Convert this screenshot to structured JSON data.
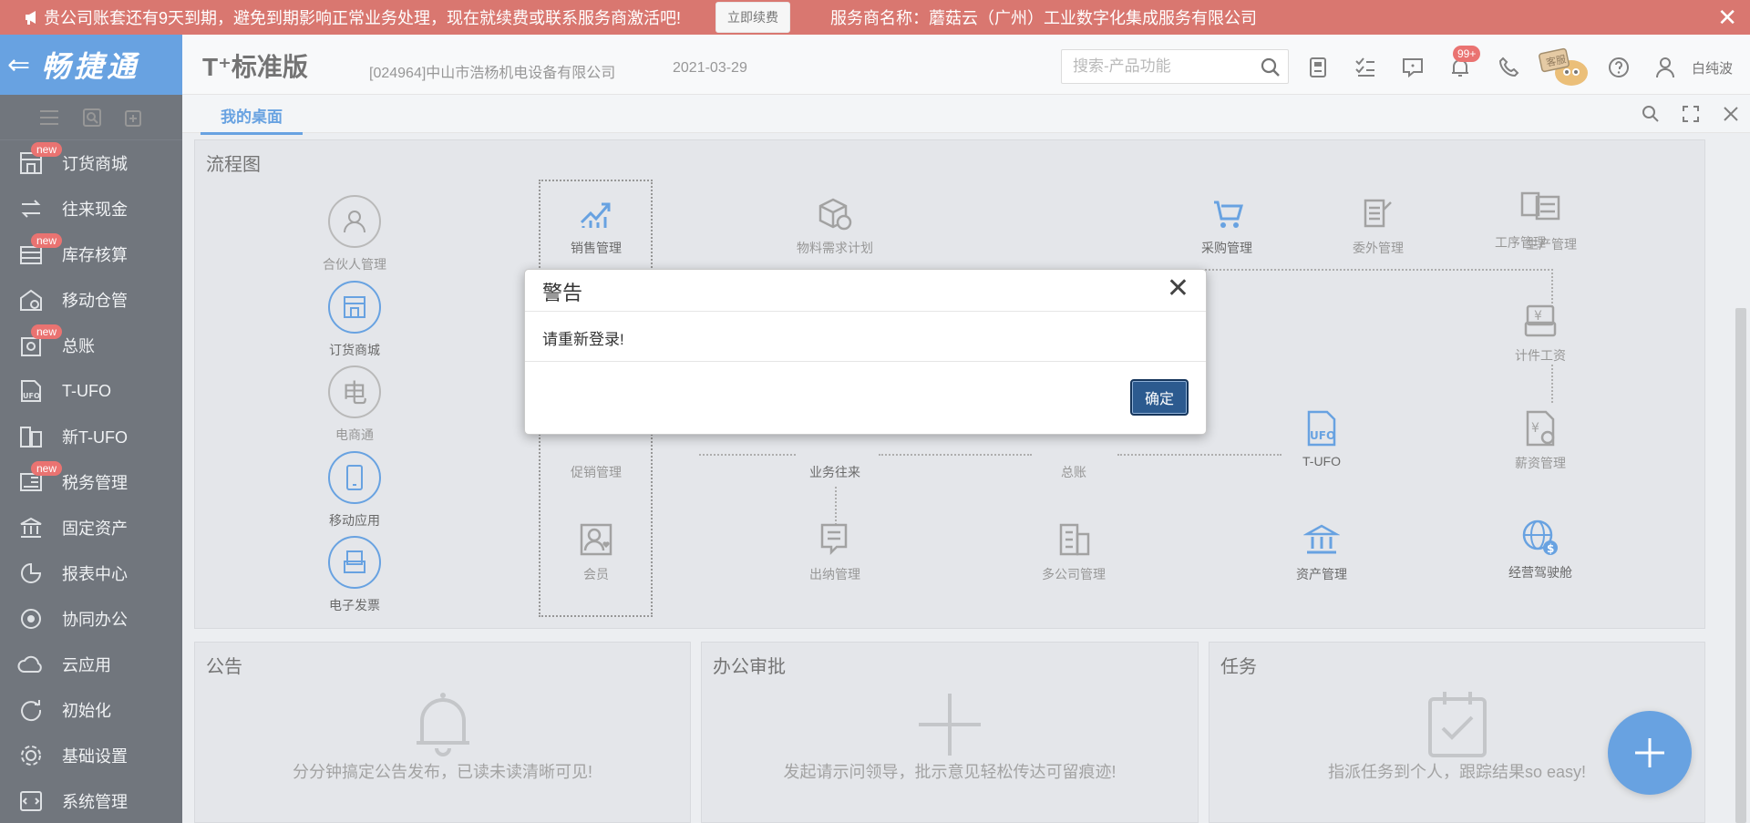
{
  "banner": {
    "message": "贵公司账套还有9天到期，避免到期影响正常业务处理，现在就续费或联系服务商激活吧!",
    "renew_label": "立即续费",
    "provider": "服务商名称：蘑菇云（广州）工业数字化集成服务有限公司",
    "close": "✕"
  },
  "header": {
    "logo_text": "畅捷通",
    "edition": "T⁺标准版",
    "company": "[024964]中山市浩杨机电设备有限公司",
    "date": "2021-03-29",
    "search_placeholder": "搜索-产品功能",
    "notification_badge": "99+",
    "kefu_label": "客服",
    "username": "白纯波"
  },
  "sidebar": {
    "new_badge": "new",
    "items": [
      {
        "label": "订货商城",
        "icon": "store-icon",
        "new": true
      },
      {
        "label": "往来现金",
        "icon": "exchange-icon",
        "new": false
      },
      {
        "label": "库存核算",
        "icon": "inventory-icon",
        "new": true
      },
      {
        "label": "移动仓管",
        "icon": "warehouse-icon",
        "new": false
      },
      {
        "label": "总账",
        "icon": "ledger-icon",
        "new": true
      },
      {
        "label": "T-UFO",
        "icon": "ufo-icon",
        "new": false
      },
      {
        "label": "新T-UFO",
        "icon": "new-ufo-icon",
        "new": false
      },
      {
        "label": "税务管理",
        "icon": "tax-icon",
        "new": true
      },
      {
        "label": "固定资产",
        "icon": "bank-icon",
        "new": false
      },
      {
        "label": "报表中心",
        "icon": "pie-icon",
        "new": false
      },
      {
        "label": "协同办公",
        "icon": "collab-icon",
        "new": false
      },
      {
        "label": "云应用",
        "icon": "cloud-icon",
        "new": false
      },
      {
        "label": "初始化",
        "icon": "init-icon",
        "new": false
      },
      {
        "label": "基础设置",
        "icon": "settings-icon",
        "new": false
      },
      {
        "label": "系统管理",
        "icon": "system-icon",
        "new": false
      }
    ]
  },
  "tabs": {
    "active": "我的桌面"
  },
  "flow": {
    "title": "流程图",
    "left": [
      "合伙人管理",
      "订货商城",
      "电商通",
      "移动应用",
      "电子发票"
    ],
    "circle_glyph_ecom": "电",
    "nodes": {
      "sales": "销售管理",
      "mrp": "物料需求计划",
      "purchase": "采购管理",
      "outsource": "委外管理",
      "work": "工序管理",
      "production": "生产管理",
      "piecewage": "计件工资",
      "promo": "促销管理",
      "business": "业务往来",
      "ledger": "总账",
      "tufo": "T-UFO",
      "salary": "薪资管理",
      "member": "会员",
      "cashier": "出纳管理",
      "multico": "多公司管理",
      "assets": "资产管理",
      "cockpit": "经营驾驶舱"
    }
  },
  "panels": {
    "notice": {
      "title": "公告",
      "desc": "分分钟搞定公告发布，已读未读清晰可见!"
    },
    "approval": {
      "title": "办公审批",
      "desc": "发起请示问领导，批示意见轻松传达可留痕迹!"
    },
    "task": {
      "title": "任务",
      "desc": "指派任务到个人，跟踪结果so easy!"
    }
  },
  "dialog": {
    "title": "警告",
    "message": "请重新登录!",
    "ok_label": "确定",
    "close": "✕"
  },
  "colors": {
    "brand": "#2177d3",
    "banner": "#c8372d",
    "sidebar": "#2f3640",
    "badge": "#e0312f"
  }
}
